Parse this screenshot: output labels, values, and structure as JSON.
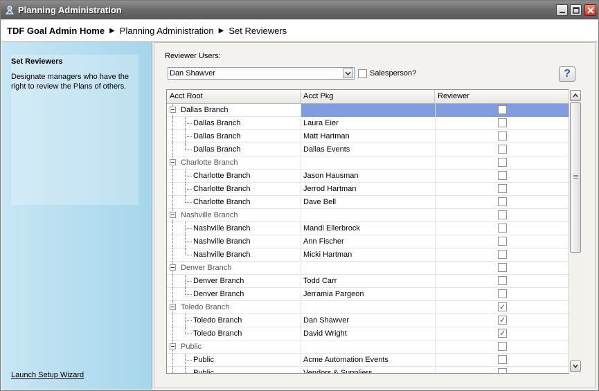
{
  "window": {
    "title": "Planning Administration"
  },
  "breadcrumb": {
    "items": [
      "TDF Goal Admin Home",
      "Planning Administration",
      "Set Reviewers"
    ]
  },
  "sidebar": {
    "heading": "Set Reviewers",
    "description": "Designate managers who have the right to review the Plans of others.",
    "wizard_link": "Launch Setup Wizard"
  },
  "form": {
    "reviewer_label": "Reviewer Users:",
    "reviewer_value": "Dan Shawver",
    "salesperson_label": "Salesperson?",
    "salesperson_checked": false,
    "help_label": "?"
  },
  "grid": {
    "columns": [
      "Acct Root",
      "Acct Pkg",
      "Reviewer"
    ],
    "selection_color": "#7f9ddf",
    "rows": [
      {
        "type": "group",
        "name": "Dallas Branch",
        "pkg": "",
        "reviewer": false,
        "selected": true
      },
      {
        "type": "child",
        "name": "Dallas Branch",
        "pkg": "Laura Eier",
        "reviewer": false
      },
      {
        "type": "child",
        "name": "Dallas Branch",
        "pkg": "Matt Hartman",
        "reviewer": false
      },
      {
        "type": "child",
        "name": "Dallas Branch",
        "pkg": "Dallas Events",
        "reviewer": false,
        "last": true
      },
      {
        "type": "group",
        "name": "Charlotte Branch",
        "pkg": "",
        "reviewer": false
      },
      {
        "type": "child",
        "name": "Charlotte Branch",
        "pkg": "Jason Hausman",
        "reviewer": false
      },
      {
        "type": "child",
        "name": "Charlotte Branch",
        "pkg": "Jerrod Hartman",
        "reviewer": false
      },
      {
        "type": "child",
        "name": "Charlotte Branch",
        "pkg": "Dave Bell",
        "reviewer": false,
        "last": true
      },
      {
        "type": "group",
        "name": "Nashville Branch",
        "pkg": "",
        "reviewer": false
      },
      {
        "type": "child",
        "name": "Nashville Branch",
        "pkg": "Mandi Ellerbrock",
        "reviewer": false
      },
      {
        "type": "child",
        "name": "Nashville Branch",
        "pkg": "Ann Fischer",
        "reviewer": false
      },
      {
        "type": "child",
        "name": "Nashville Branch",
        "pkg": "Micki Hartman",
        "reviewer": false,
        "last": true
      },
      {
        "type": "group",
        "name": "Denver Branch",
        "pkg": "",
        "reviewer": false
      },
      {
        "type": "child",
        "name": "Denver Branch",
        "pkg": "Todd Carr",
        "reviewer": false
      },
      {
        "type": "child",
        "name": "Denver Branch",
        "pkg": "Jerramia Pargeon",
        "reviewer": false,
        "last": true
      },
      {
        "type": "group",
        "name": "Toledo Branch",
        "pkg": "",
        "reviewer": true
      },
      {
        "type": "child",
        "name": "Toledo Branch",
        "pkg": "Dan Shawver",
        "reviewer": true
      },
      {
        "type": "child",
        "name": "Toledo Branch",
        "pkg": "David Wright",
        "reviewer": true,
        "last": true
      },
      {
        "type": "group",
        "name": "Public",
        "pkg": "",
        "reviewer": false
      },
      {
        "type": "child",
        "name": "Public",
        "pkg": "Acme Automation Events",
        "reviewer": false
      },
      {
        "type": "child",
        "name": "Public",
        "pkg": "Vendors & Suppliers",
        "reviewer": false
      }
    ]
  }
}
